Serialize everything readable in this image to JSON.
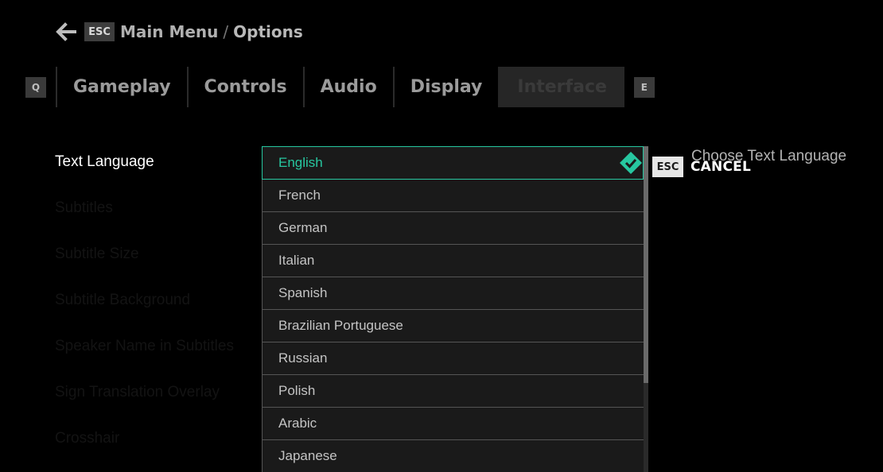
{
  "breadcrumb": {
    "back_icon": "arrow-left-icon",
    "key": "ESC",
    "parent": "Main Menu",
    "separator": "/",
    "current": "Options"
  },
  "tabs": {
    "prev_key": "Q",
    "next_key": "E",
    "items": [
      {
        "label": "Gameplay",
        "active": false
      },
      {
        "label": "Controls",
        "active": false
      },
      {
        "label": "Audio",
        "active": false
      },
      {
        "label": "Display",
        "active": false
      },
      {
        "label": "Interface",
        "active": true
      }
    ]
  },
  "settings": [
    {
      "label": "Text Language",
      "active": true
    },
    {
      "label": "Subtitles",
      "active": false
    },
    {
      "label": "Subtitle Size",
      "active": false
    },
    {
      "label": "Subtitle Background",
      "active": false
    },
    {
      "label": "Speaker Name in Subtitles",
      "active": false
    },
    {
      "label": "Sign Translation Overlay",
      "active": false
    },
    {
      "label": "Crosshair",
      "active": false
    }
  ],
  "dropdown": {
    "selected": "English",
    "check_icon": "check-diamond-icon",
    "options": [
      "English",
      "French",
      "German",
      "Italian",
      "Spanish",
      "Brazilian Portuguese",
      "Russian",
      "Polish",
      "Arabic",
      "Japanese"
    ]
  },
  "hint": {
    "title": "Choose Text Language",
    "cancel_key": "ESC",
    "cancel_label": "CANCEL"
  },
  "colors": {
    "accent": "#27c7a0",
    "background": "#000000",
    "item_background": "#1a1a1a"
  }
}
